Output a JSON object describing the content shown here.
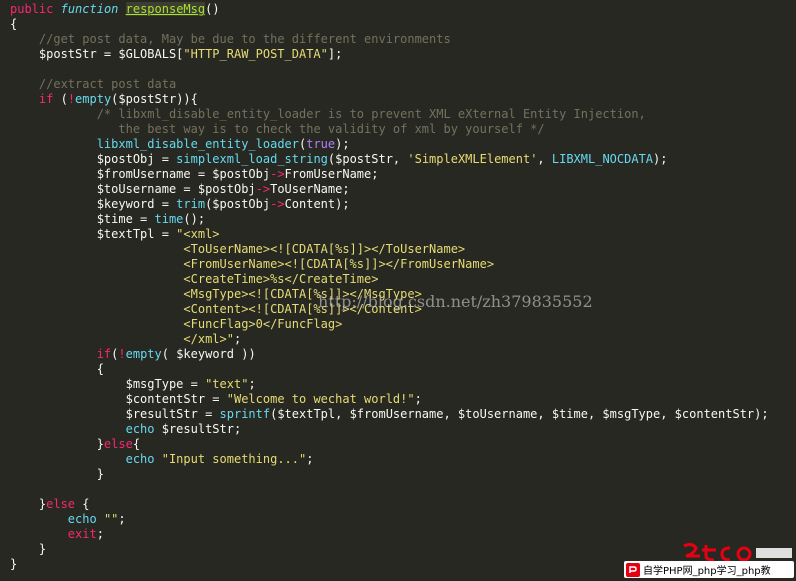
{
  "code_lines": [
    [
      [
        "tok-kw",
        "public"
      ],
      [
        "tok-plain",
        " "
      ],
      [
        "tok-storage",
        "function"
      ],
      [
        "tok-plain",
        " "
      ],
      [
        "tok-fnname",
        "responseMsg"
      ],
      [
        "tok-plain",
        "()"
      ]
    ],
    [
      [
        "tok-plain",
        "{"
      ]
    ],
    [
      [
        "tok-plain",
        "    "
      ],
      [
        "tok-comment",
        "//get post data, May be due to the different environments"
      ]
    ],
    [
      [
        "tok-plain",
        "    $postStr = $GLOBALS["
      ],
      [
        "tok-str",
        "\"HTTP_RAW_POST_DATA\""
      ],
      [
        "tok-plain",
        "];"
      ]
    ],
    [
      [
        "tok-plain",
        " "
      ]
    ],
    [
      [
        "tok-plain",
        "    "
      ],
      [
        "tok-comment",
        "//extract post data"
      ]
    ],
    [
      [
        "tok-plain",
        "    "
      ],
      [
        "tok-kw",
        "if"
      ],
      [
        "tok-plain",
        " ("
      ],
      [
        "tok-kw",
        "!"
      ],
      [
        "tok-builtin",
        "empty"
      ],
      [
        "tok-plain",
        "($postStr)){"
      ]
    ],
    [
      [
        "tok-plain",
        "            "
      ],
      [
        "tok-comment",
        "/* libxml_disable_entity_loader is to prevent XML eXternal Entity Injection,"
      ]
    ],
    [
      [
        "tok-plain",
        "               "
      ],
      [
        "tok-comment",
        "the best way is to check the validity of xml by yourself */"
      ]
    ],
    [
      [
        "tok-plain",
        "            "
      ],
      [
        "tok-builtin",
        "libxml_disable_entity_loader"
      ],
      [
        "tok-plain",
        "("
      ],
      [
        "tok-const",
        "true"
      ],
      [
        "tok-plain",
        ");"
      ]
    ],
    [
      [
        "tok-plain",
        "            $postObj = "
      ],
      [
        "tok-builtin",
        "simplexml_load_string"
      ],
      [
        "tok-plain",
        "($postStr, "
      ],
      [
        "tok-str",
        "'SimpleXMLElement'"
      ],
      [
        "tok-plain",
        ", "
      ],
      [
        "tok-builtin",
        "LIBXML_NOCDATA"
      ],
      [
        "tok-plain",
        ");"
      ]
    ],
    [
      [
        "tok-plain",
        "            $fromUsername = $postObj"
      ],
      [
        "tok-kw",
        "->"
      ],
      [
        "tok-plain",
        "FromUserName;"
      ]
    ],
    [
      [
        "tok-plain",
        "            $toUsername = $postObj"
      ],
      [
        "tok-kw",
        "->"
      ],
      [
        "tok-plain",
        "ToUserName;"
      ]
    ],
    [
      [
        "tok-plain",
        "            $keyword = "
      ],
      [
        "tok-builtin",
        "trim"
      ],
      [
        "tok-plain",
        "($postObj"
      ],
      [
        "tok-kw",
        "->"
      ],
      [
        "tok-plain",
        "Content);"
      ]
    ],
    [
      [
        "tok-plain",
        "            $time = "
      ],
      [
        "tok-builtin",
        "time"
      ],
      [
        "tok-plain",
        "();"
      ]
    ],
    [
      [
        "tok-plain",
        "            $textTpl = "
      ],
      [
        "tok-str",
        "\"<xml>"
      ]
    ],
    [
      [
        "tok-plain",
        "                        "
      ],
      [
        "tok-str",
        "<ToUserName><![CDATA[%s]]></ToUserName>"
      ]
    ],
    [
      [
        "tok-plain",
        "                        "
      ],
      [
        "tok-str",
        "<FromUserName><![CDATA[%s]]></FromUserName>"
      ]
    ],
    [
      [
        "tok-plain",
        "                        "
      ],
      [
        "tok-str",
        "<CreateTime>%s</CreateTime>"
      ]
    ],
    [
      [
        "tok-plain",
        "                        "
      ],
      [
        "tok-str",
        "<MsgType><![CDATA[%s]]></MsgType>"
      ]
    ],
    [
      [
        "tok-plain",
        "                        "
      ],
      [
        "tok-str",
        "<Content><![CDATA[%s]]></Content>"
      ]
    ],
    [
      [
        "tok-plain",
        "                        "
      ],
      [
        "tok-str",
        "<FuncFlag>0</FuncFlag>"
      ]
    ],
    [
      [
        "tok-plain",
        "                        "
      ],
      [
        "tok-str",
        "</xml>\""
      ],
      [
        "tok-plain",
        ";"
      ]
    ],
    [
      [
        "tok-plain",
        "            "
      ],
      [
        "tok-kw",
        "if"
      ],
      [
        "tok-plain",
        "("
      ],
      [
        "tok-kw",
        "!"
      ],
      [
        "tok-builtin",
        "empty"
      ],
      [
        "tok-plain",
        "( $keyword ))"
      ]
    ],
    [
      [
        "tok-plain",
        "            {"
      ]
    ],
    [
      [
        "tok-plain",
        "                $msgType = "
      ],
      [
        "tok-str",
        "\"text\""
      ],
      [
        "tok-plain",
        ";"
      ]
    ],
    [
      [
        "tok-plain",
        "                $contentStr = "
      ],
      [
        "tok-str",
        "\"Welcome to wechat world!\""
      ],
      [
        "tok-plain",
        ";"
      ]
    ],
    [
      [
        "tok-plain",
        "                $resultStr = "
      ],
      [
        "tok-builtin",
        "sprintf"
      ],
      [
        "tok-plain",
        "($textTpl, $fromUsername, $toUsername, $time, $msgType, $contentStr);"
      ]
    ],
    [
      [
        "tok-plain",
        "                "
      ],
      [
        "tok-builtin",
        "echo"
      ],
      [
        "tok-plain",
        " $resultStr;"
      ]
    ],
    [
      [
        "tok-plain",
        "            }"
      ],
      [
        "tok-kw",
        "else"
      ],
      [
        "tok-plain",
        "{"
      ]
    ],
    [
      [
        "tok-plain",
        "                "
      ],
      [
        "tok-builtin",
        "echo"
      ],
      [
        "tok-plain",
        " "
      ],
      [
        "tok-str",
        "\"Input something...\""
      ],
      [
        "tok-plain",
        ";"
      ]
    ],
    [
      [
        "tok-plain",
        "            }"
      ]
    ],
    [
      [
        "tok-plain",
        " "
      ]
    ],
    [
      [
        "tok-plain",
        "    }"
      ],
      [
        "tok-kw",
        "else"
      ],
      [
        "tok-plain",
        " {"
      ]
    ],
    [
      [
        "tok-plain",
        "        "
      ],
      [
        "tok-builtin",
        "echo"
      ],
      [
        "tok-plain",
        " "
      ],
      [
        "tok-str",
        "\"\""
      ],
      [
        "tok-plain",
        ";"
      ]
    ],
    [
      [
        "tok-plain",
        "        "
      ],
      [
        "tok-kw",
        "exit"
      ],
      [
        "tok-plain",
        ";"
      ]
    ],
    [
      [
        "tok-plain",
        "    }"
      ]
    ],
    [
      [
        "tok-plain",
        "}"
      ]
    ]
  ],
  "watermark": "http://blog.csdn.net/zh379835552",
  "logo": {
    "tagline": "自学PHP网_php学习_php教",
    "icon": "php-site-logo-icon"
  },
  "colors": {
    "background": "#272822",
    "keyword": "#f92672",
    "string": "#e6db74",
    "comment": "#75715e",
    "function": "#a6e22e",
    "builtin": "#66d9ef"
  }
}
